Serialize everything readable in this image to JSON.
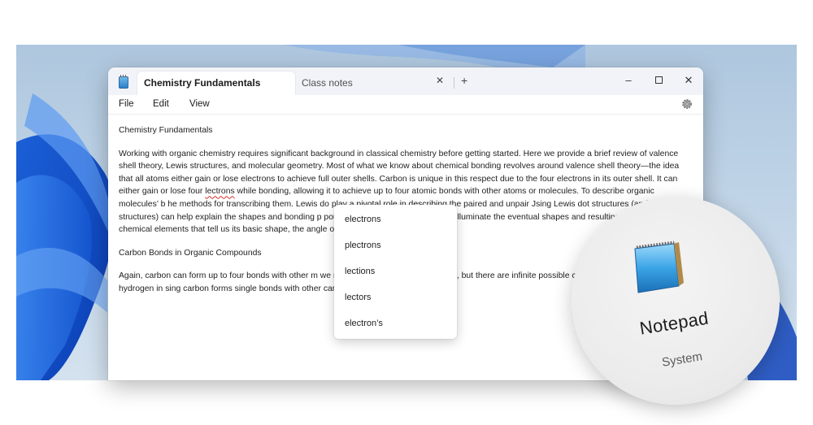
{
  "window": {
    "tabs": [
      {
        "label": "Chemistry Fundamentals",
        "active": true
      },
      {
        "label": "Class notes",
        "active": false
      }
    ],
    "close_tab_glyph": "✕",
    "new_tab_glyph": "+",
    "controls": {
      "minimize": "–",
      "close": "✕"
    }
  },
  "menu": {
    "file": "File",
    "edit": "Edit",
    "view": "View"
  },
  "document": {
    "title": "Chemistry Fundamentals",
    "para1_a": "Working with organic chemistry requires significant background in classical chemistry before getting started. Here we provide a brief review of valence shell theory, Lewis structures, and molecular geometry. Most of what we know about chemical bonding revolves around valence shell theory—the idea that all atoms either gain or lose electrons to achieve full outer shells. Carbon is unique in this respect due to the four electrons in its outer shell. It can either gain or lose four ",
    "para1_misspelled": "lectrons",
    "para1_b": " while bonding, allowing it to achieve up to four atomic bonds with other atoms or molecules. To describe organic molecules’ b he methods for transcribing them. Lewis do play a pivotal role in describing the paired and unpair Jsing Lewis dot structures (and examin structures) can help explain the shapes and bonding p pounds. Understanding the electro illuminate the eventual shapes and resulting bonds in ving the chemical elements that tell us its basic shape, the angle of its bonds, and its u",
    "heading2": "Carbon Bonds in Organic Compounds",
    "para2": "Again, carbon can form up to four bonds with other m we mainly focus on carbon o oxygen, but there are infinite possible compounds. In ds with four hydrogen in sing carbon forms single bonds with other carbons to create longer chains."
  },
  "suggestions": [
    "electrons",
    "plectrons",
    "lections",
    "lectors",
    "electron’s"
  ],
  "zoom_callout": {
    "app_name": "Notepad",
    "app_type": "System"
  },
  "colors": {
    "accent_blue": "#2a7fc8",
    "spell_error": "#d0312d"
  }
}
